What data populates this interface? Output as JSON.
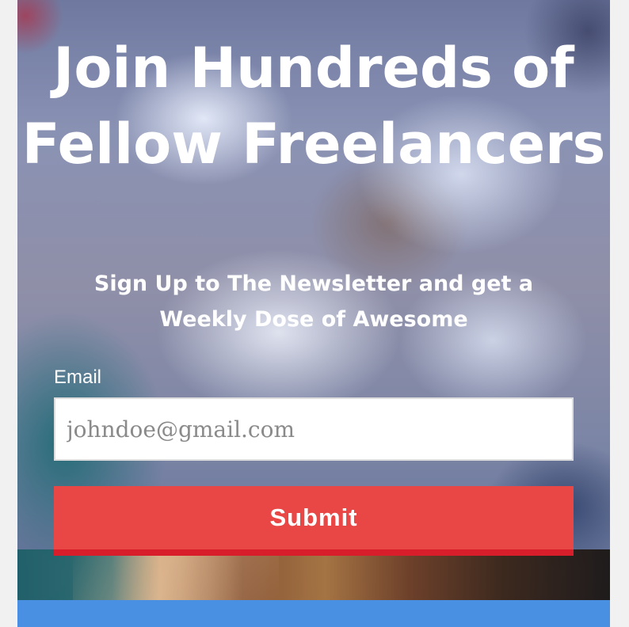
{
  "signup": {
    "title": "Join Hundreds of Fellow Freelancers",
    "subtitle": "Sign Up to The Newsletter and get a Weekly Dose of Awesome",
    "email_label": "Email",
    "email_placeholder": "johndoe@gmail.com",
    "email_value": "",
    "submit_label": "Submit"
  },
  "colors": {
    "submit_background": "#e84745",
    "submit_border": "#d81e2b",
    "bottom_bar": "#4a90e2",
    "text": "#ffffff"
  }
}
